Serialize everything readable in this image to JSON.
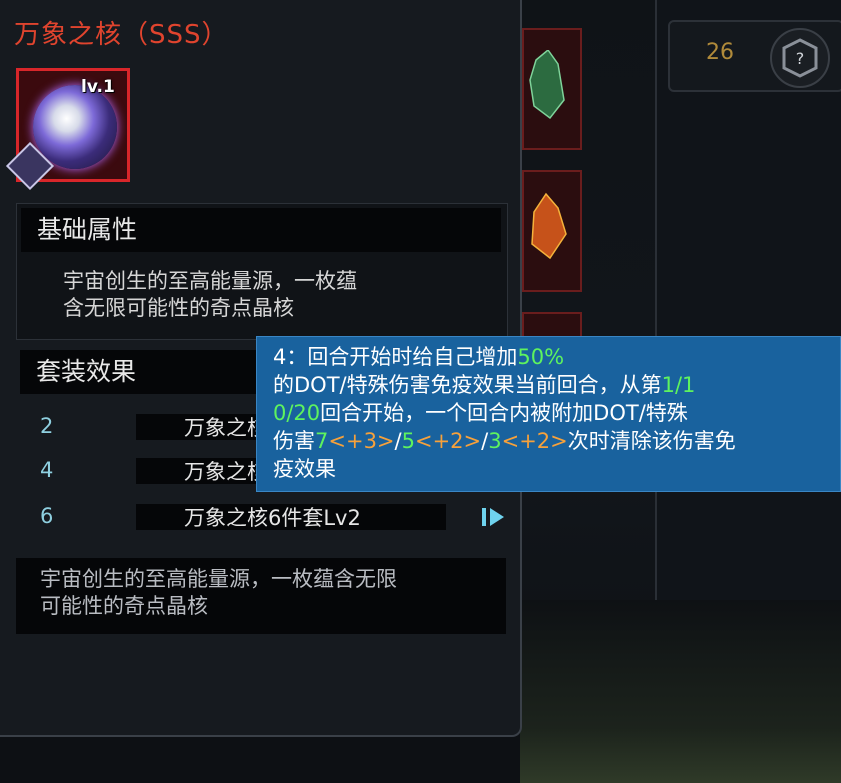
{
  "counter": {
    "value": "26"
  },
  "item": {
    "title": "万象之核（SSS）",
    "level": "lv.1"
  },
  "base_section": {
    "heading": "基础属性",
    "desc_line1": "宇宙创生的至高能量源，一枚蕴",
    "desc_line2": "含无限可能性的奇点晶核"
  },
  "set_section": {
    "heading": "套装效果",
    "rows": [
      {
        "count": "2",
        "name": "万象之核"
      },
      {
        "count": "4",
        "name": "万象之核"
      },
      {
        "count": "6",
        "name": "万象之核6件套Lv2"
      }
    ]
  },
  "footer_desc": {
    "line1": "宇宙创生的至高能量源，一枚蕴含无限",
    "line2": "可能性的奇点晶核"
  },
  "tooltip": {
    "line1_a": "4：回合开始时给自己增加",
    "line1_b": "50%",
    "line2_a": "的DOT/特殊伤害免疫效果当前回合，从第",
    "line2_b": "1/1",
    "line3_a": "0/20",
    "line3_b": "回合开始，一个回合内被附加DOT/特殊",
    "line4_a": "伤害",
    "v1": "7",
    "v1b": "<+3>",
    "sep1": "/",
    "v2": "5",
    "v2b": "<+2>",
    "sep2": "/",
    "v3": "3",
    "v3b": "<+2>",
    "line4_b": "次时清除该伤害免",
    "line5": "疫效果"
  },
  "colors": {
    "title_red": "#e0442e",
    "tooltip_bg": "#19629e",
    "green": "#5ef35e",
    "orange": "#f6a13b"
  }
}
